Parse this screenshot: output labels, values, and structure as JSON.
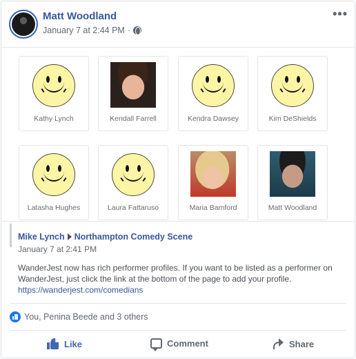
{
  "post": {
    "author": "Matt Woodland",
    "timestamp": "January 7 at 2:44 PM",
    "separator": "·",
    "privacy_icon": "globe-icon",
    "menu_icon": "more-options-icon",
    "menu_glyph": "•••"
  },
  "performers": [
    {
      "name": "Kathy Lynch",
      "image": "smiley"
    },
    {
      "name": "Kendall Farrell",
      "image": "photo"
    },
    {
      "name": "Kendra Dawsey",
      "image": "smiley"
    },
    {
      "name": "Kim DeShields",
      "image": "smiley"
    },
    {
      "name": "Latasha Hughes",
      "image": "smiley"
    },
    {
      "name": "Laura Fattaruso",
      "image": "smiley"
    },
    {
      "name": "Maria Bamford",
      "image": "photo"
    },
    {
      "name": "Matt Woodland",
      "image": "photo"
    }
  ],
  "shared_post": {
    "author": "Mike Lynch",
    "target": "Northampton Comedy Scene",
    "timestamp": "January 7 at 2:41 PM",
    "body_line1": "WanderJest now has rich performer profiles. If you want to be listed as a performer on",
    "body_line2": "WanderJest, just click the link at the bottom of the page to add your profile.",
    "link": "https://wanderjest.com/comedians"
  },
  "reactions": {
    "summary": "You, Penina Beede and 3 others"
  },
  "actions": {
    "like": "Like",
    "comment": "Comment",
    "share": "Share"
  },
  "colors": {
    "link_blue": "#365899",
    "like_active": "#4267b2",
    "smiley_fill": "#fdf5a6"
  }
}
